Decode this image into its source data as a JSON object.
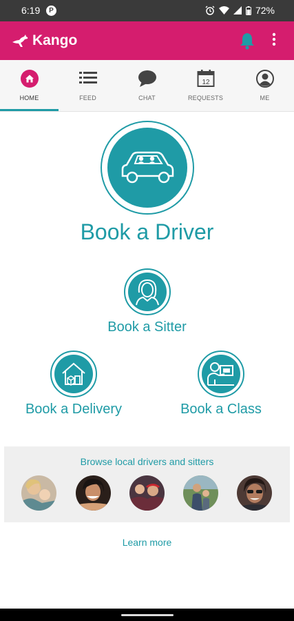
{
  "status_bar": {
    "time": "6:19",
    "notification_icon": "circle-p-icon",
    "battery": "72%"
  },
  "app_bar": {
    "title": "Kango",
    "logo_icon": "kangaroo-icon",
    "color": "#d51d6e"
  },
  "tabs": [
    {
      "label": "HOME",
      "icon": "home-icon",
      "active": true
    },
    {
      "label": "FEED",
      "icon": "list-icon",
      "active": false
    },
    {
      "label": "CHAT",
      "icon": "chat-bubble-icon",
      "active": false
    },
    {
      "label": "REQUESTS",
      "icon": "calendar-icon",
      "calendar_day": "12",
      "active": false
    },
    {
      "label": "ME",
      "icon": "person-icon",
      "active": false
    }
  ],
  "main": {
    "book_driver": "Book a Driver",
    "book_sitter": "Book a Sitter",
    "book_delivery": "Book a Delivery",
    "book_class": "Book a Class",
    "accent_color": "#1f9ba6"
  },
  "browse": {
    "heading": "Browse local drivers and sitters",
    "profiles": [
      {
        "icon": "profile-photo-icon"
      },
      {
        "icon": "profile-photo-icon"
      },
      {
        "icon": "profile-photo-icon"
      },
      {
        "icon": "profile-photo-icon"
      },
      {
        "icon": "profile-photo-icon"
      }
    ]
  },
  "learn_more": "Learn more"
}
